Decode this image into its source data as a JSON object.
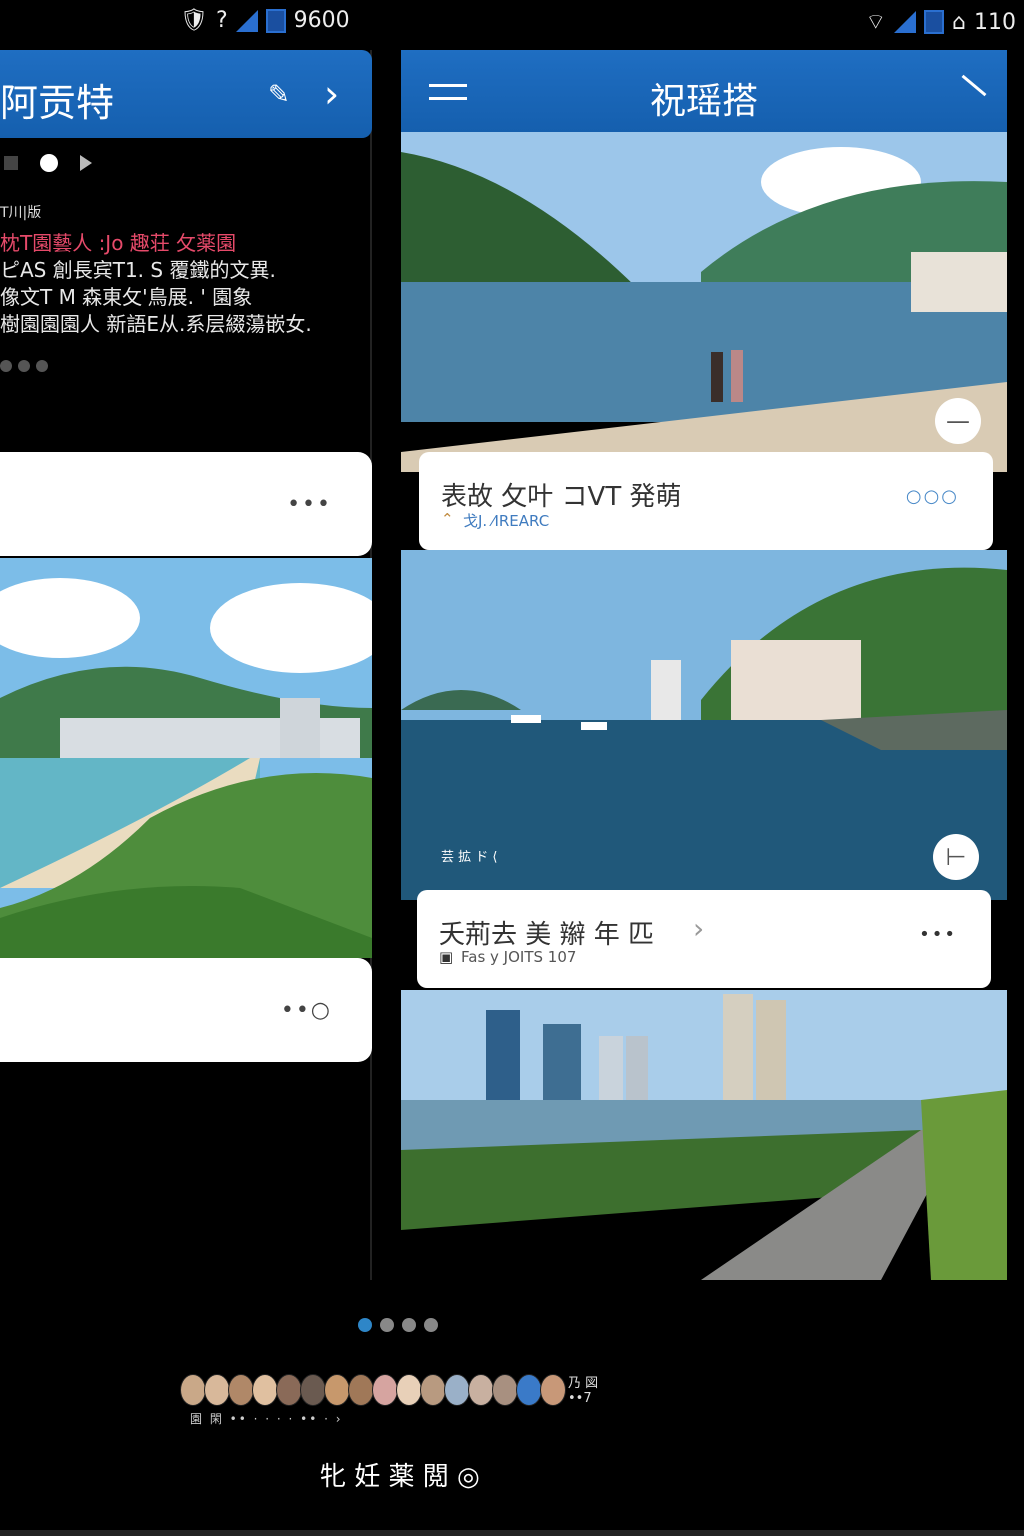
{
  "status_bar": {
    "left_time": "9600",
    "right_text": "110"
  },
  "left_panel": {
    "title": "阿贡特",
    "subtitle": "T川|版",
    "body_lines": [
      "枕T園藝人 :Jo 趣荘 攵薬園",
      "ピAS 創長宾T1. S 覆鐵的文異.",
      "像文T M 森東攵'鳥展.   ' 園象",
      "樹園園園人 新語E从.系层綴蕩嵌女."
    ],
    "card1_more": "•••",
    "card2_more": "••○"
  },
  "right_panel": {
    "title": "祝瑶搭",
    "card1": {
      "title": "表故 攵叶 コVT 発萌",
      "subtitle": "戈J. ⁄IREARC",
      "more": "○○○"
    },
    "card2": {
      "title": "夭荊去 美 辮 年 匹",
      "subtitle": "Fas y JOITS 107",
      "more": "•••"
    },
    "overlay_caption": "芸 拡 ド ⟨"
  },
  "pager": {
    "count": 4,
    "active": 0
  },
  "avatars": {
    "label_top": "乃 図",
    "label_bottom": "••7",
    "row2": "園 閑 •• ·  ·  ·  · •• · ›"
  },
  "bottom_label": "牝 妊 薬 閲 ◎",
  "colors": {
    "header_blue": "#1f6ec2",
    "accent": "#2e86c8"
  }
}
